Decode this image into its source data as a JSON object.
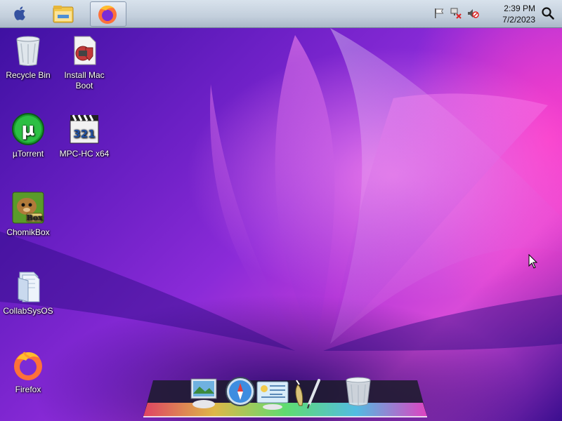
{
  "taskbar": {
    "apple_icon": "apple-icon",
    "pinned": [
      {
        "name": "file-explorer-icon"
      },
      {
        "name": "firefox-icon"
      }
    ],
    "tray_icons": [
      "action-center-flag-icon",
      "network-disconnected-icon",
      "volume-muted-icon"
    ],
    "clock": {
      "time": "2:39 PM",
      "date": "7/2/2023"
    },
    "search_icon": "search-icon"
  },
  "desktop": {
    "icons": [
      {
        "label": "Recycle Bin",
        "icon": "recycle-bin-icon"
      },
      {
        "label": "Install Mac Boot",
        "icon": "install-mac-boot-icon"
      },
      {
        "label": "µTorrent",
        "icon": "utorrent-icon"
      },
      {
        "label": "MPC-HC x64",
        "icon": "mpc-hc-icon"
      },
      {
        "label": "ChomikBox",
        "icon": "chomikbox-icon"
      },
      {
        "label": "CollabSysOS",
        "icon": "folder-icon"
      },
      {
        "label": "Firefox",
        "icon": "firefox-icon"
      }
    ],
    "mpc_badge": "321",
    "chomik_badge": "Box"
  },
  "dock": {
    "items": [
      "preview-icon",
      "safari-icon",
      "address-book-icon",
      "utilities-icon",
      "trash-icon"
    ]
  },
  "colors": {
    "menubar_top": "#d8e2ec",
    "menubar_bottom": "#aab8c8",
    "wallpaper_primary": "#6a1fc4",
    "wallpaper_accent": "#d84bd9"
  }
}
